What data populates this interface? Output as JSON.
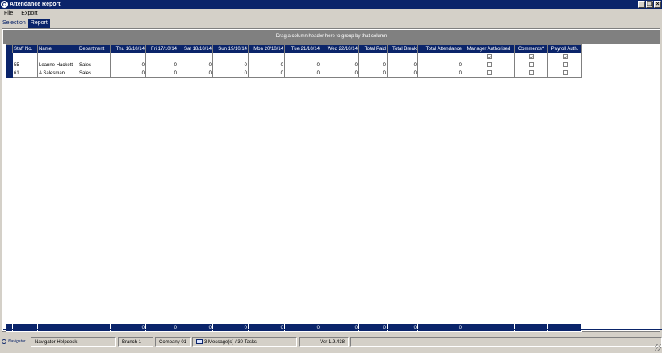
{
  "window": {
    "title": "Attendance Report"
  },
  "menu": [
    "File",
    "Export"
  ],
  "tabs": [
    {
      "label": "Selection",
      "active": false
    },
    {
      "label": "Report",
      "active": true
    }
  ],
  "grid": {
    "group_hint": "Drag a column header here to group by that column",
    "columns": [
      "Staff No.",
      "Name",
      "Department",
      "Thu 16/10/14",
      "Fri 17/10/14",
      "Sat 18/10/14",
      "Sun 19/10/14",
      "Mon 20/10/14",
      "Tue 21/10/14",
      "Wed 22/10/14",
      "Total Paid",
      "Total Break",
      "Total Attendance",
      "Manager Authorised",
      "Comments?",
      "Payroll Auth."
    ],
    "rows": [
      {
        "staff_no": "55",
        "name": "Leanne Hackett",
        "department": "Sales",
        "values": [
          "0",
          "0",
          "0",
          "0",
          "0",
          "0",
          "0",
          "0",
          "0",
          "0"
        ],
        "manager_authorised": false,
        "comments": false,
        "payroll_auth": false
      },
      {
        "staff_no": "61",
        "name": "A Salesman",
        "department": "Sales",
        "values": [
          "0",
          "0",
          "0",
          "0",
          "0",
          "0",
          "0",
          "0",
          "0",
          "0"
        ],
        "manager_authorised": false,
        "comments": false,
        "payroll_auth": false
      }
    ],
    "footer_totals": [
      "0",
      "0",
      "0",
      "0",
      "0",
      "0",
      "0",
      "0",
      "0",
      "0"
    ]
  },
  "status": {
    "app": "Navigator",
    "helpdesk": "Navigator Helpdesk",
    "branch": "Branch 1",
    "company": "Company 01",
    "messages": "3 Message(s) / 30 Tasks",
    "version": "Ver 1.9.438"
  },
  "colors": {
    "titlebar": "#0a246a",
    "header": "#0a246a",
    "groupbar": "#808080",
    "chrome": "#d4d0c8"
  },
  "icons": {
    "app": "app-logo-icon",
    "messages": "envelope-icon"
  }
}
